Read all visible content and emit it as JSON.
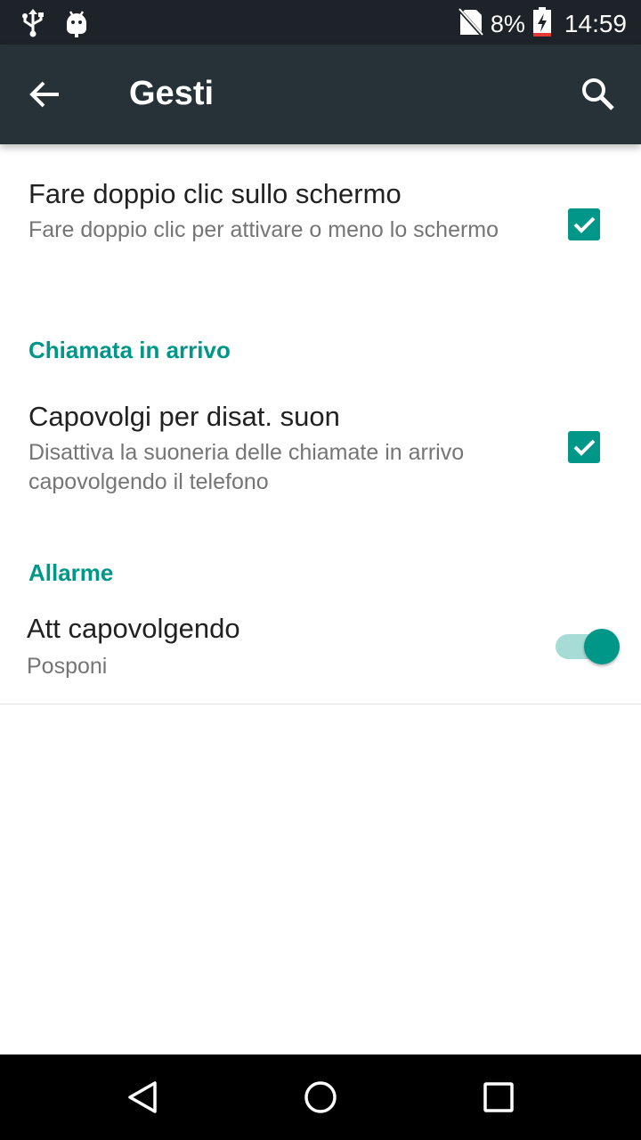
{
  "status_bar": {
    "battery_percent": "8%",
    "time": "14:59",
    "icons": [
      "usb-icon",
      "android-debug-icon",
      "no-sim-icon",
      "battery-charging-icon"
    ]
  },
  "toolbar": {
    "title": "Gesti",
    "back_icon": "arrow-back-icon",
    "search_icon": "search-icon"
  },
  "preferences": {
    "double_tap": {
      "title": "Fare doppio clic sullo schermo",
      "summary": "Fare doppio clic per attivare o meno lo schermo",
      "checked": true
    },
    "incoming_call_header": "Chiamata in arrivo",
    "flip_mute": {
      "title": "Capovolgi per disat. suon",
      "summary": "Disattiva la suoneria delle chiamate in arrivo capovolgendo il telefono",
      "checked": true
    },
    "alarm_header": "Allarme",
    "flip_alarm": {
      "title": "Att capovolgendo",
      "summary": "Posponi",
      "enabled": true
    }
  },
  "colors": {
    "accent": "#009688",
    "toolbar": "#263238",
    "status_bar": "#1d2328",
    "switch_track": "#a7dcd6"
  },
  "nav_bar": {
    "icons": [
      "back-triangle-icon",
      "home-circle-icon",
      "recents-square-icon"
    ]
  }
}
